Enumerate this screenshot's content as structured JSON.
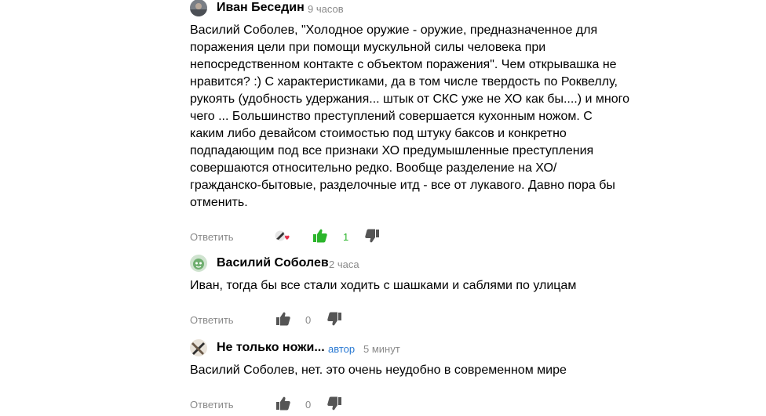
{
  "comments": [
    {
      "author": "Иван Беседин",
      "time": "9 часов",
      "badge": "",
      "text_lines": [
        "Василий Соболев, \"Холодное оружие - оружие, предназначенное для",
        "поражения цели при помощи мускульной силы человека при",
        "непосредственном контакте с объектом поражения\". Чем открывашка не",
        "нравится? :) С характеристиками, да в том числе твердость по Роквеллу,",
        "рукоять (удобность удержания... штык от СКС уже не ХО как бы....) и много",
        "чего ... Большинство преступлений совершается кухонным ножом. С",
        "каким либо девайсом стоимостью под штуку баксов и конкретно",
        "подпадающим под все признаки ХО предумышленные преступления",
        "совершаются относительно редко. Вообще разделение на ХО/",
        "гражданско-бытовые, разделочные итд - все от лукавого. Давно пора бы",
        "отменить."
      ],
      "reply_label": "Ответить",
      "likes": "1",
      "liked": true
    },
    {
      "author": "Василий Соболев",
      "time": "2 часа",
      "badge": "",
      "text_lines": [
        "Иван, тогда бы все стали ходить с шашками и саблями по улицам"
      ],
      "reply_label": "Ответить",
      "likes": "0",
      "liked": false
    },
    {
      "author": "Не только ножи...",
      "time": "5 минут",
      "badge": "автор",
      "text_lines": [
        "Василий Соболев, нет. это очень неудобно в современном мире"
      ],
      "reply_label": "Ответить",
      "likes": "0",
      "liked": false
    }
  ],
  "colors": {
    "text": "#000000",
    "muted": "#8a8a8a",
    "like_active": "#2bb52b",
    "author_badge": "#2a7ad3",
    "icon": "#555555"
  },
  "icons": {
    "like": "thumbs-up-icon",
    "dislike": "thumbs-down-icon",
    "reaction": "heart-icon"
  }
}
